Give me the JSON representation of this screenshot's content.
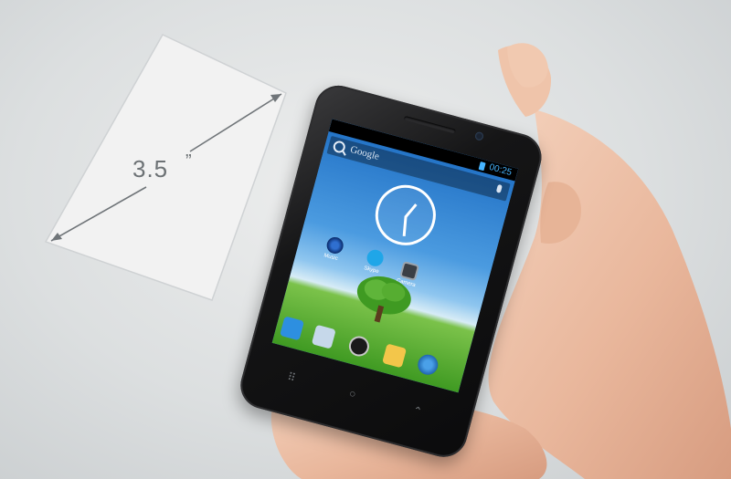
{
  "diagram": {
    "size_value": "3.5",
    "size_unit": "”"
  },
  "phone": {
    "status_time": "00:25",
    "search_brand": "Google",
    "app_labels": [
      "Music",
      "Skype",
      "Camera"
    ],
    "colors": {
      "status_accent": "#46b4ff",
      "body": "#111112"
    }
  }
}
